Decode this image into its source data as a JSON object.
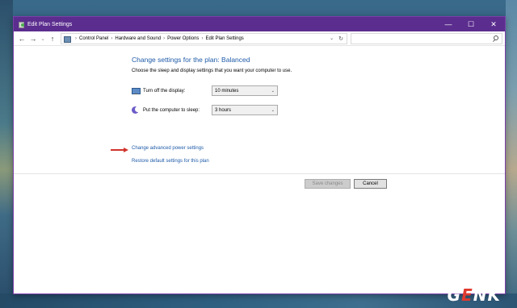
{
  "window": {
    "title": "Edit Plan Settings"
  },
  "titlebar_controls": {
    "minimize": "—",
    "maximize": "☐",
    "close": "✕"
  },
  "nav": {
    "back": "←",
    "forward": "→",
    "recent": "⌄",
    "up": "↑"
  },
  "breadcrumb": {
    "items": [
      "Control Panel",
      "Hardware and Sound",
      "Power Options",
      "Edit Plan Settings"
    ],
    "separator": "›",
    "dropdown": "⌄",
    "refresh": "↻"
  },
  "search": {
    "icon": "search-icon"
  },
  "main": {
    "heading": "Change settings for the plan: Balanced",
    "subheading": "Choose the sleep and display settings that you want your computer to use.",
    "settings": [
      {
        "label": "Turn off the display:",
        "value": "10 minutes",
        "icon": "monitor-icon"
      },
      {
        "label": "Put the computer to sleep:",
        "value": "3 hours",
        "icon": "moon-icon"
      }
    ],
    "links": [
      "Change advanced power settings",
      "Restore default settings for this plan"
    ]
  },
  "buttons": {
    "save": "Save changes",
    "cancel": "Cancel"
  },
  "watermark": {
    "prefix": "G",
    "accent": "E",
    "suffix": "NK"
  },
  "colors": {
    "titlebar": "#5b2d8e",
    "link": "#1e5aa8",
    "arrow": "#d0342c"
  }
}
